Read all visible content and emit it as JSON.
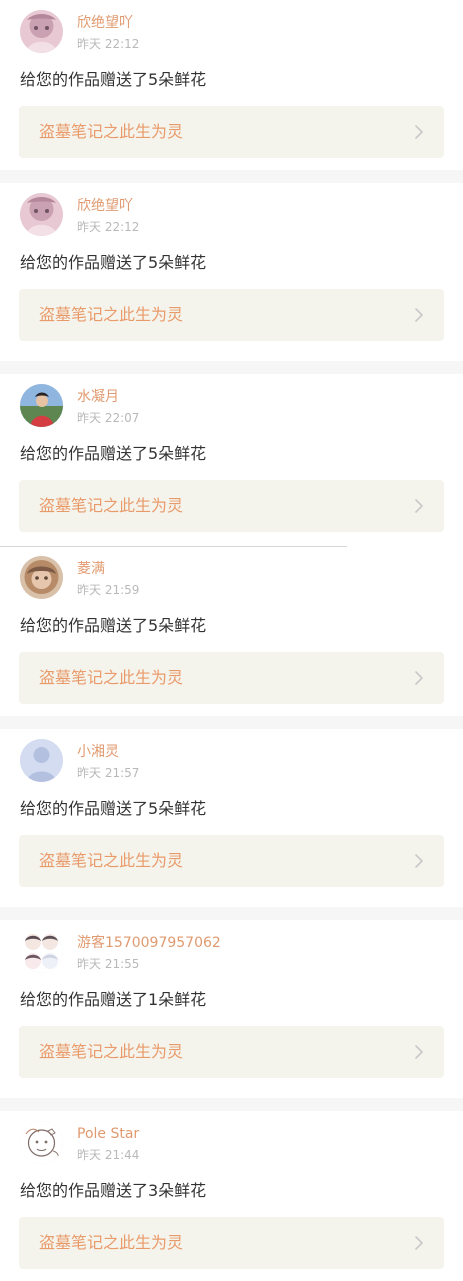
{
  "colors": {
    "username": "#e19a6f",
    "timestamp": "#b9b9b9",
    "message": "#333333",
    "work_link_background": "#f5f4ec",
    "work_title": "#e99a6a",
    "divider": "#f6f6f6"
  },
  "feed": {
    "items": [
      {
        "avatar": "pink-hair-avatar",
        "username": "欣绝望吖",
        "time": "昨天 22:12",
        "message": "给您的作品赠送了5朵鲜花",
        "work_title": "盗墓笔记之此生为灵"
      },
      {
        "avatar": "pink-hair-avatar",
        "username": "欣绝望吖",
        "time": "昨天 22:12",
        "message": "给您的作品赠送了5朵鲜花",
        "work_title": "盗墓笔记之此生为灵"
      },
      {
        "avatar": "outdoor-person-avatar",
        "username": "水凝月",
        "time": "昨天 22:07",
        "message": "给您的作品赠送了5朵鲜花",
        "work_title": "盗墓笔记之此生为灵"
      },
      {
        "avatar": "curly-hair-avatar",
        "username": "菱满",
        "time": "昨天 21:59",
        "message": "给您的作品赠送了5朵鲜花",
        "work_title": "盗墓笔记之此生为灵"
      },
      {
        "avatar": "default-person-avatar",
        "username": "小湘灵",
        "time": "昨天 21:57",
        "message": "给您的作品赠送了5朵鲜花",
        "work_title": "盗墓笔记之此生为灵"
      },
      {
        "avatar": "cartoon-group-avatar",
        "username": "游客1570097957062",
        "time": "昨天 21:55",
        "message": "给您的作品赠送了1朵鲜花",
        "work_title": "盗墓笔记之此生为灵"
      },
      {
        "avatar": "sketch-avatar",
        "username": "Pole Star",
        "time": "昨天 21:44",
        "message": "给您的作品赠送了3朵鲜花",
        "work_title": "盗墓笔记之此生为灵"
      }
    ]
  }
}
